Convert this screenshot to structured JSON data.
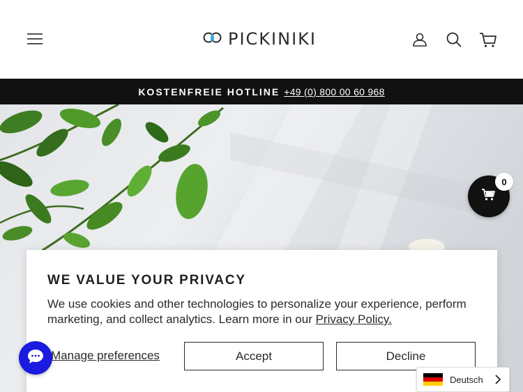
{
  "header": {
    "logo_text": "PICKINIKI",
    "icons": [
      "hamburger-icon",
      "logo-icon",
      "account-icon",
      "search-icon",
      "cart-icon"
    ]
  },
  "announcement": {
    "label": "KOSTENFREIE HOTLINE",
    "phone": "+49 (0) 800 00 60 968"
  },
  "floating_cart": {
    "count": "0"
  },
  "privacy": {
    "title": "WE VALUE YOUR PRIVACY",
    "body": "We use cookies and other technologies to personalize your experience, perform marketing, and collect analytics. Learn more in our ",
    "policy_link": "Privacy Policy.",
    "manage": "Manage preferences",
    "accept": "Accept",
    "decline": "Decline"
  },
  "language": {
    "selected": "Deutsch"
  },
  "colors": {
    "announcement_bg": "#111111",
    "chat_bg": "#1a1ae0",
    "logo_drop": "#3aa7e6"
  }
}
